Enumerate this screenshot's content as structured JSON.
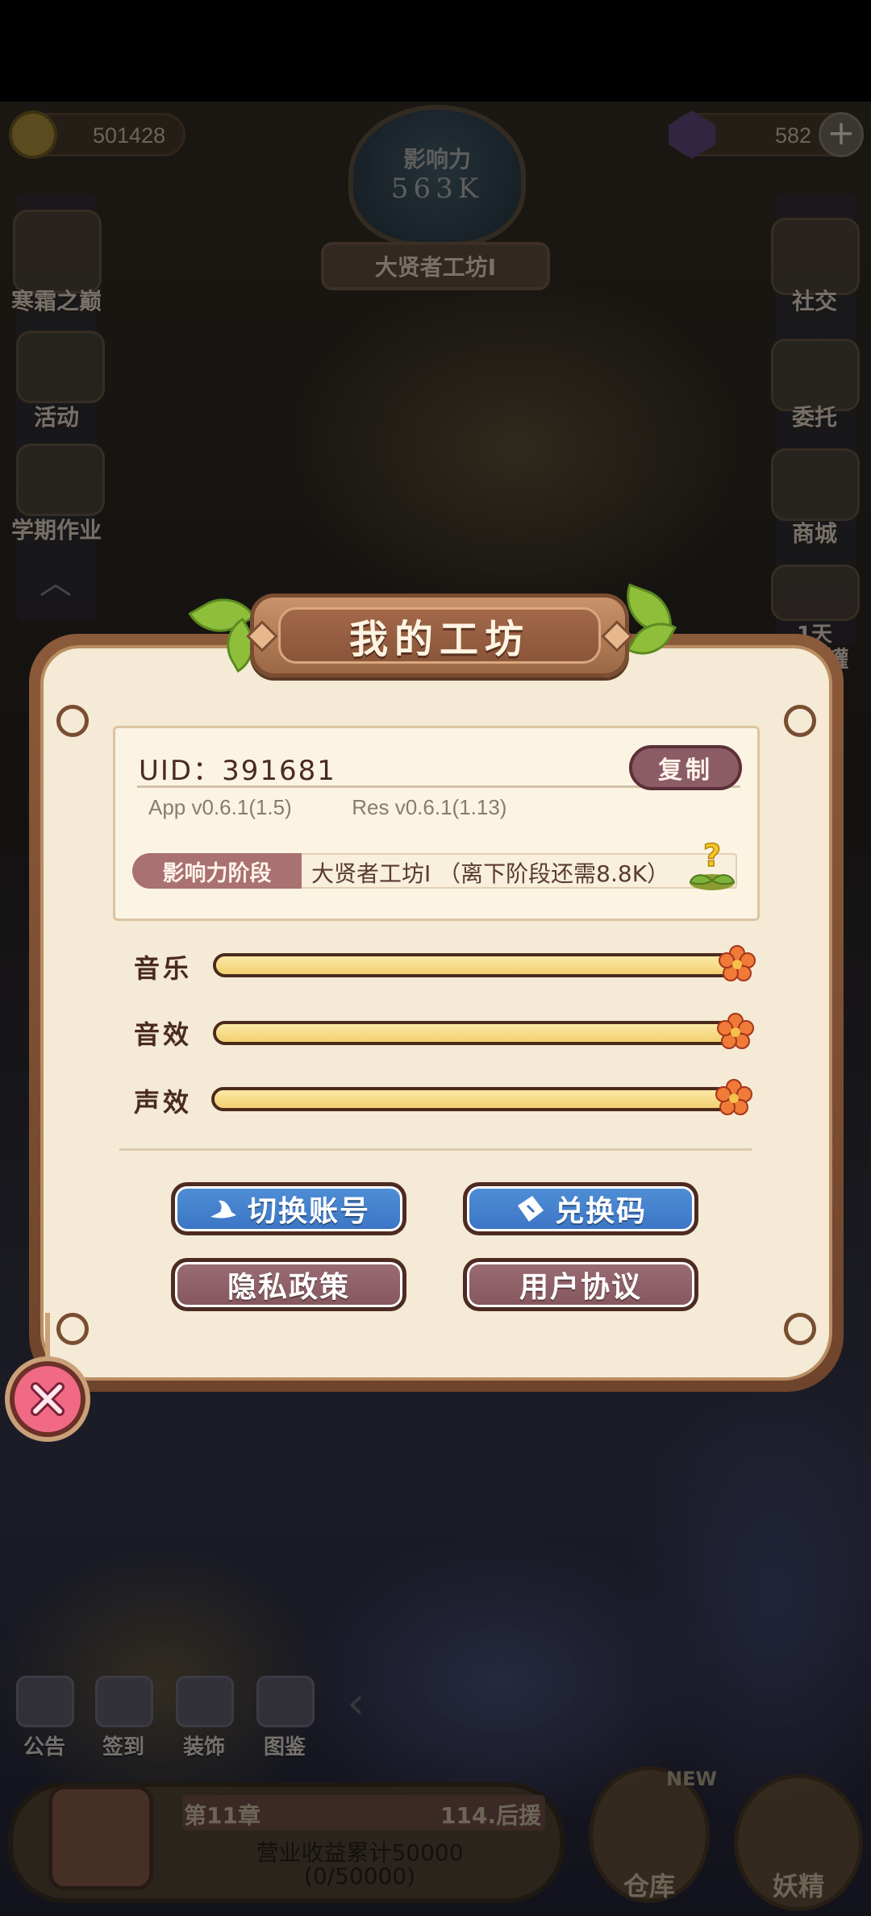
{
  "hud": {
    "coins": "501428",
    "influence_label": "影响力",
    "influence_value": "563K",
    "workshop_rank": "大贤者工坊I",
    "gems": "582"
  },
  "left_menu": [
    "寒霜之巅",
    "活动",
    "学期作业"
  ],
  "right_menu": [
    "社交",
    "委托",
    "商城",
    "1天",
    "储蓄罐"
  ],
  "dialog": {
    "title": "我的工坊",
    "uid": "UID：391681",
    "copy_label": "复制",
    "app_version": "App v0.6.1(1.5)",
    "res_version": "Res v0.6.1(1.13)",
    "stage_label": "影响力阶段",
    "stage_value": "大贤者工坊I （离下阶段还需8.8K）",
    "sliders": [
      {
        "label": "音乐",
        "level": 1.0
      },
      {
        "label": "音效",
        "level": 1.0
      },
      {
        "label": "声效",
        "level": 1.0
      }
    ],
    "buttons": {
      "switch_account": "切换账号",
      "redeem_code": "兑换码",
      "privacy_policy": "隐私政策",
      "user_agreement": "用户协议"
    }
  },
  "bottom_bar": {
    "icons": [
      "公告",
      "签到",
      "装饰",
      "图鉴"
    ],
    "chapter": "第11章",
    "chapter_task": "114.后援",
    "quest_text": "营业收益累计50000",
    "quest_progress": "(0/50000)",
    "warehouse": "仓库",
    "warehouse_badge": "NEW",
    "fairy": "妖精"
  }
}
